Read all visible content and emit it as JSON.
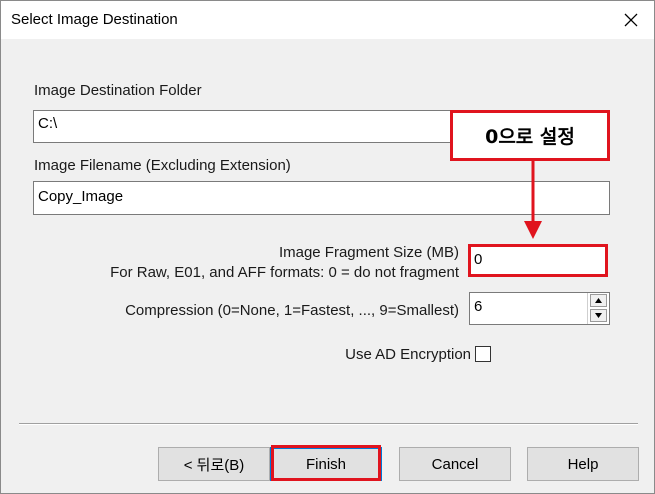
{
  "window": {
    "title": "Select Image Destination"
  },
  "form": {
    "folder_label": "Image Destination Folder",
    "folder_value": "C:\\",
    "filename_label": "Image Filename (Excluding Extension)",
    "filename_value": "Copy_Image",
    "fragment_label_line1": "Image Fragment Size (MB)",
    "fragment_label_line2": "For Raw, E01, and AFF formats: 0 = do not fragment",
    "fragment_value": "0",
    "compression_label": "Compression (0=None, 1=Fastest, ..., 9=Smallest)",
    "compression_value": "6",
    "encryption_label": "Use AD Encryption",
    "encryption_checked": false
  },
  "annotation": {
    "callout_text": "0으로 설정",
    "highlight_color": "#e0141e"
  },
  "buttons": {
    "back": "< 뒤로(B)",
    "finish": "Finish",
    "cancel": "Cancel",
    "help": "Help"
  },
  "icons": {
    "close": "close-icon",
    "spin_up": "spin-up-icon",
    "spin_down": "spin-down-icon"
  }
}
